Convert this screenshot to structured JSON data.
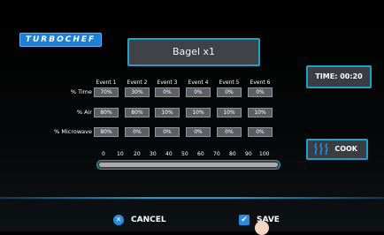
{
  "brand": {
    "logo_text": "TURBOCHEF"
  },
  "recipe": {
    "name": "Bagel x1"
  },
  "time_button": {
    "label": "TIME: 00:20"
  },
  "cook_button": {
    "label": "COOK",
    "icon": "heat-waves-icon"
  },
  "events": {
    "headers": [
      "Event 1",
      "Event 2",
      "Event 3",
      "Event 4",
      "Event 5",
      "Event 6"
    ],
    "rows": [
      {
        "label": "% Time",
        "values": [
          "70%",
          "30%",
          "0%",
          "0%",
          "0%",
          "0%"
        ]
      },
      {
        "label": "% Air",
        "values": [
          "80%",
          "80%",
          "10%",
          "10%",
          "10%",
          "10%"
        ]
      },
      {
        "label": "% Microwave",
        "values": [
          "80%",
          "0%",
          "0%",
          "0%",
          "0%",
          "0%"
        ]
      }
    ]
  },
  "slider": {
    "ticks": [
      "0",
      "10",
      "20",
      "30",
      "40",
      "50",
      "60",
      "70",
      "80",
      "90",
      "100"
    ]
  },
  "footer": {
    "cancel_label": "CANCEL",
    "cancel_icon": "close-circle-icon",
    "save_label": "SAVE",
    "save_icon": "checkbox-icon"
  },
  "colors": {
    "accent": "#1ea0c8",
    "logo": "#1e7fd3",
    "icon_blue": "#2a8ce0",
    "cell": "#5b5e63"
  }
}
